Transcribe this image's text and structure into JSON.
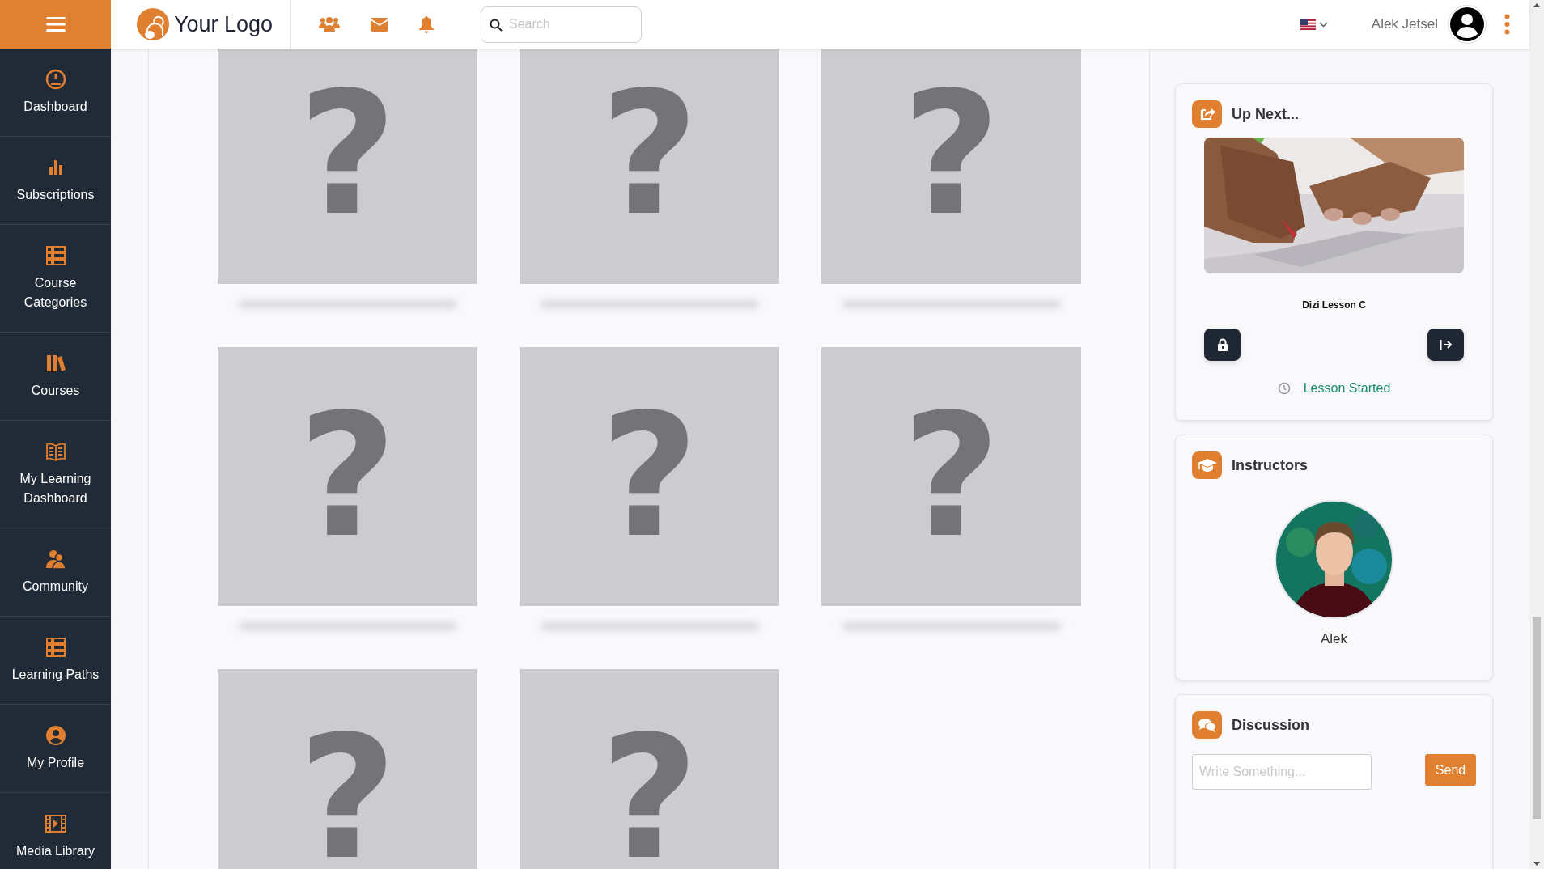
{
  "top_bar": {
    "logo": "Your Logo",
    "search": {
      "placeholder": "Search"
    },
    "user_name": "Alek Jetsel"
  },
  "sidebar": {
    "items": [
      {
        "label": "Dashboard"
      },
      {
        "label": "Subscriptions"
      },
      {
        "label": "Course Categories"
      },
      {
        "label": "Courses"
      },
      {
        "label": "My Learning Dashboard"
      },
      {
        "label": "Community"
      },
      {
        "label": "Learning Paths"
      },
      {
        "label": "My Profile"
      },
      {
        "label": "Media Library"
      }
    ]
  },
  "content": {
    "tiles": [
      {
        "symbol": "?"
      },
      {
        "symbol": "?"
      },
      {
        "symbol": "?"
      },
      {
        "symbol": "?"
      },
      {
        "symbol": "?"
      },
      {
        "symbol": "?"
      },
      {
        "symbol": "?"
      },
      {
        "symbol": "?"
      }
    ]
  },
  "up_next": {
    "title": "Up Next...",
    "lesson_title": "Dizi Lesson C",
    "status": "Lesson Started"
  },
  "instructors": {
    "title": "Instructors",
    "items": [
      {
        "name": "Alek"
      }
    ]
  },
  "discussion": {
    "title": "Discussion",
    "input": {
      "placeholder": "Write Something..."
    },
    "send_button": "Send"
  }
}
